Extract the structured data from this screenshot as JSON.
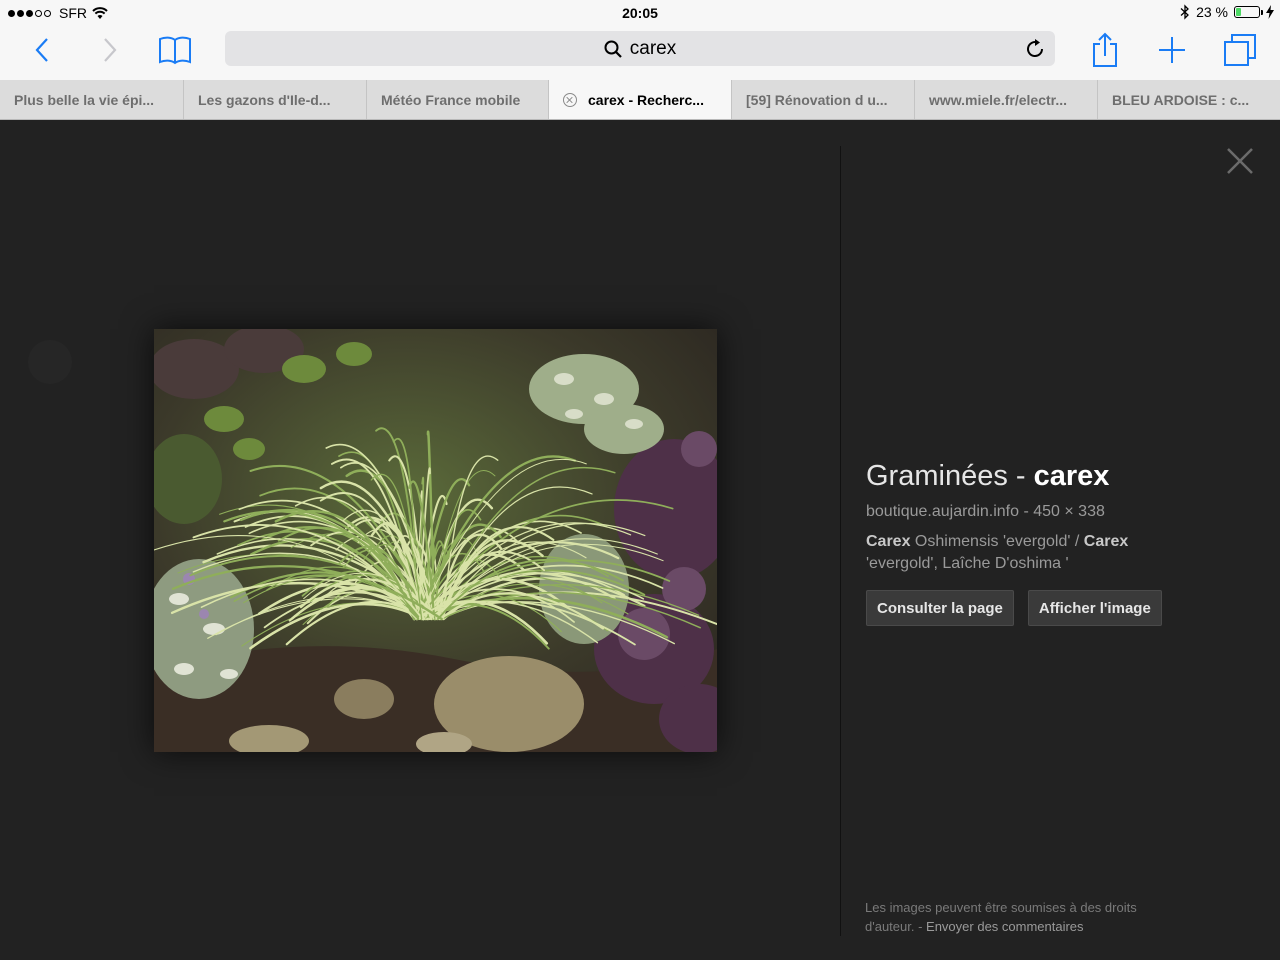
{
  "status_bar": {
    "carrier": "SFR",
    "time": "20:05",
    "battery_text": "23 %",
    "battery_level": 0.23
  },
  "toolbar": {
    "search_text": "carex"
  },
  "tabs": [
    {
      "label": "Plus belle la vie épi...",
      "active": false
    },
    {
      "label": "Les gazons d'Ile-d...",
      "active": false
    },
    {
      "label": "Météo France mobile",
      "active": false
    },
    {
      "label": "carex - Recherc...",
      "active": true
    },
    {
      "label": "[59] Rénovation d u...",
      "active": false
    },
    {
      "label": "www.miele.fr/electr...",
      "active": false
    },
    {
      "label": "BLEU ARDOISE : c...",
      "active": false
    }
  ],
  "viewer": {
    "title_prefix": "Graminées - ",
    "title_bold": "carex",
    "source": "boutique.aujardin.info",
    "separator": " - ",
    "dimensions": "450 × 338",
    "desc_1_bold": "Carex",
    "desc_2": " Oshimensis 'evergold' / ",
    "desc_3_bold": "Carex",
    "desc_4": " 'evergold', Laîche D'oshima '",
    "visit_button": "Consulter la page",
    "view_button": "Afficher l'image",
    "footer_text": "Les images peuvent être soumises à des droits d'auteur.",
    "footer_sep": " - ",
    "footer_link": "Envoyer des commentaires"
  },
  "colors": {
    "accent": "#1a7cf5",
    "viewer_bg": "#222222"
  }
}
